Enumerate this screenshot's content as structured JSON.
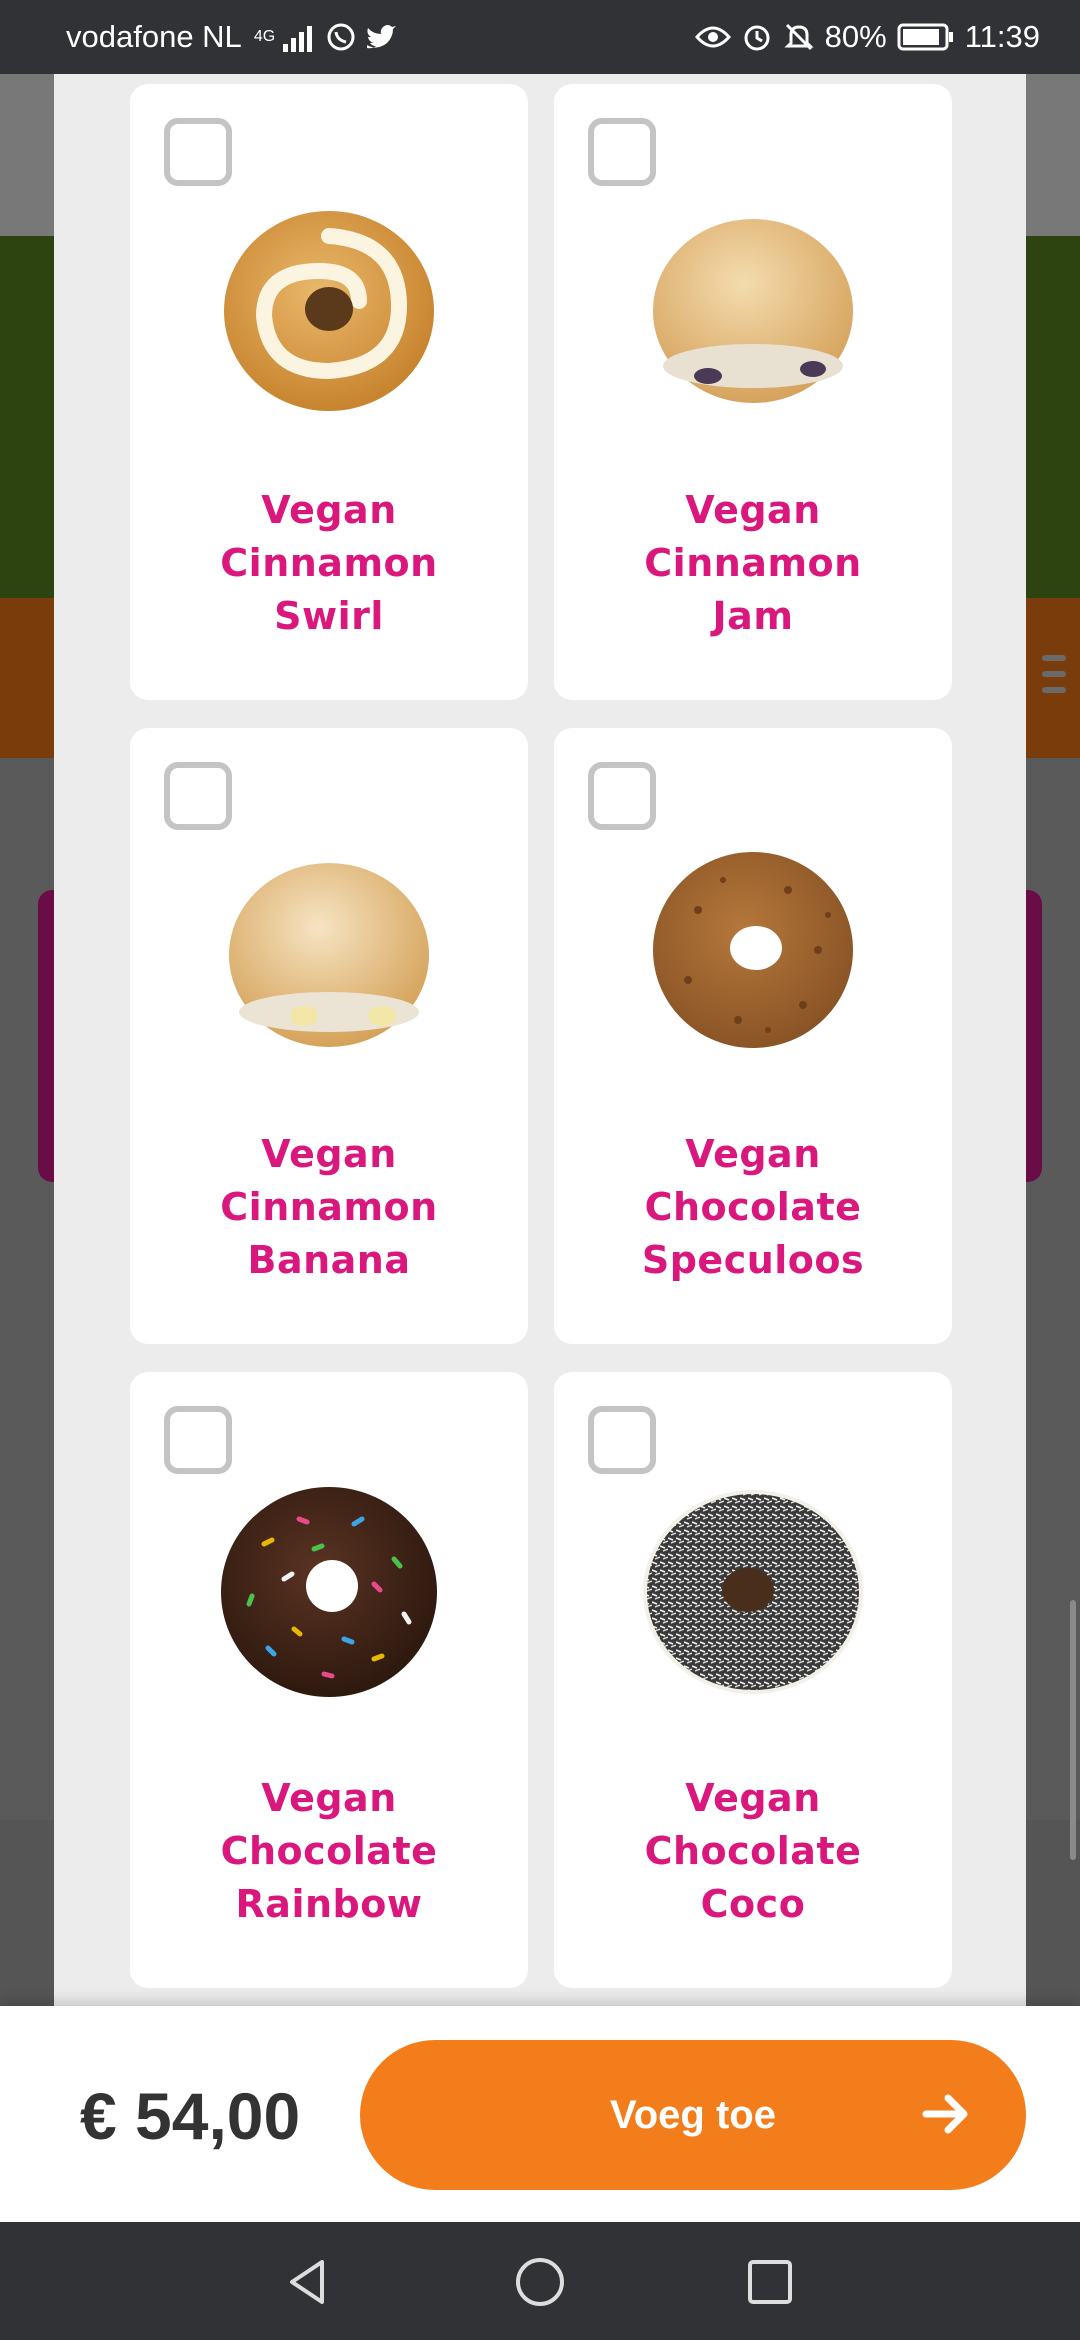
{
  "status_bar": {
    "carrier": "vodafone NL",
    "network": "4G",
    "battery": "80%",
    "time": "11:39",
    "icons": [
      "signal-icon",
      "whatsapp-icon",
      "twitter-icon",
      "eye-icon",
      "alarm-icon",
      "mute-icon",
      "battery-icon"
    ]
  },
  "products": [
    {
      "name": "Vegan Cinnamon Swirl",
      "checked": false,
      "icon": "donut-cinnamon-swirl"
    },
    {
      "name": "Vegan Cinnamon Jam",
      "checked": false,
      "icon": "donut-cinnamon-jam"
    },
    {
      "name": "Vegan Cinnamon Banana",
      "checked": false,
      "icon": "donut-cinnamon-banana"
    },
    {
      "name": "Vegan Chocolate Speculoos",
      "checked": false,
      "icon": "donut-chocolate-speculoos"
    },
    {
      "name": "Vegan Chocolate Rainbow",
      "checked": false,
      "icon": "donut-chocolate-rainbow"
    },
    {
      "name": "Vegan Chocolate Coco",
      "checked": false,
      "icon": "donut-chocolate-coco"
    }
  ],
  "footer": {
    "price": "€ 54,00",
    "add_button_label": "Voeg toe"
  },
  "colors": {
    "accent": "#f27d1a",
    "product_name": "#d9177c",
    "status_bar": "#303235"
  },
  "nav": {
    "icons": [
      "back-icon",
      "home-icon",
      "recents-icon"
    ]
  }
}
